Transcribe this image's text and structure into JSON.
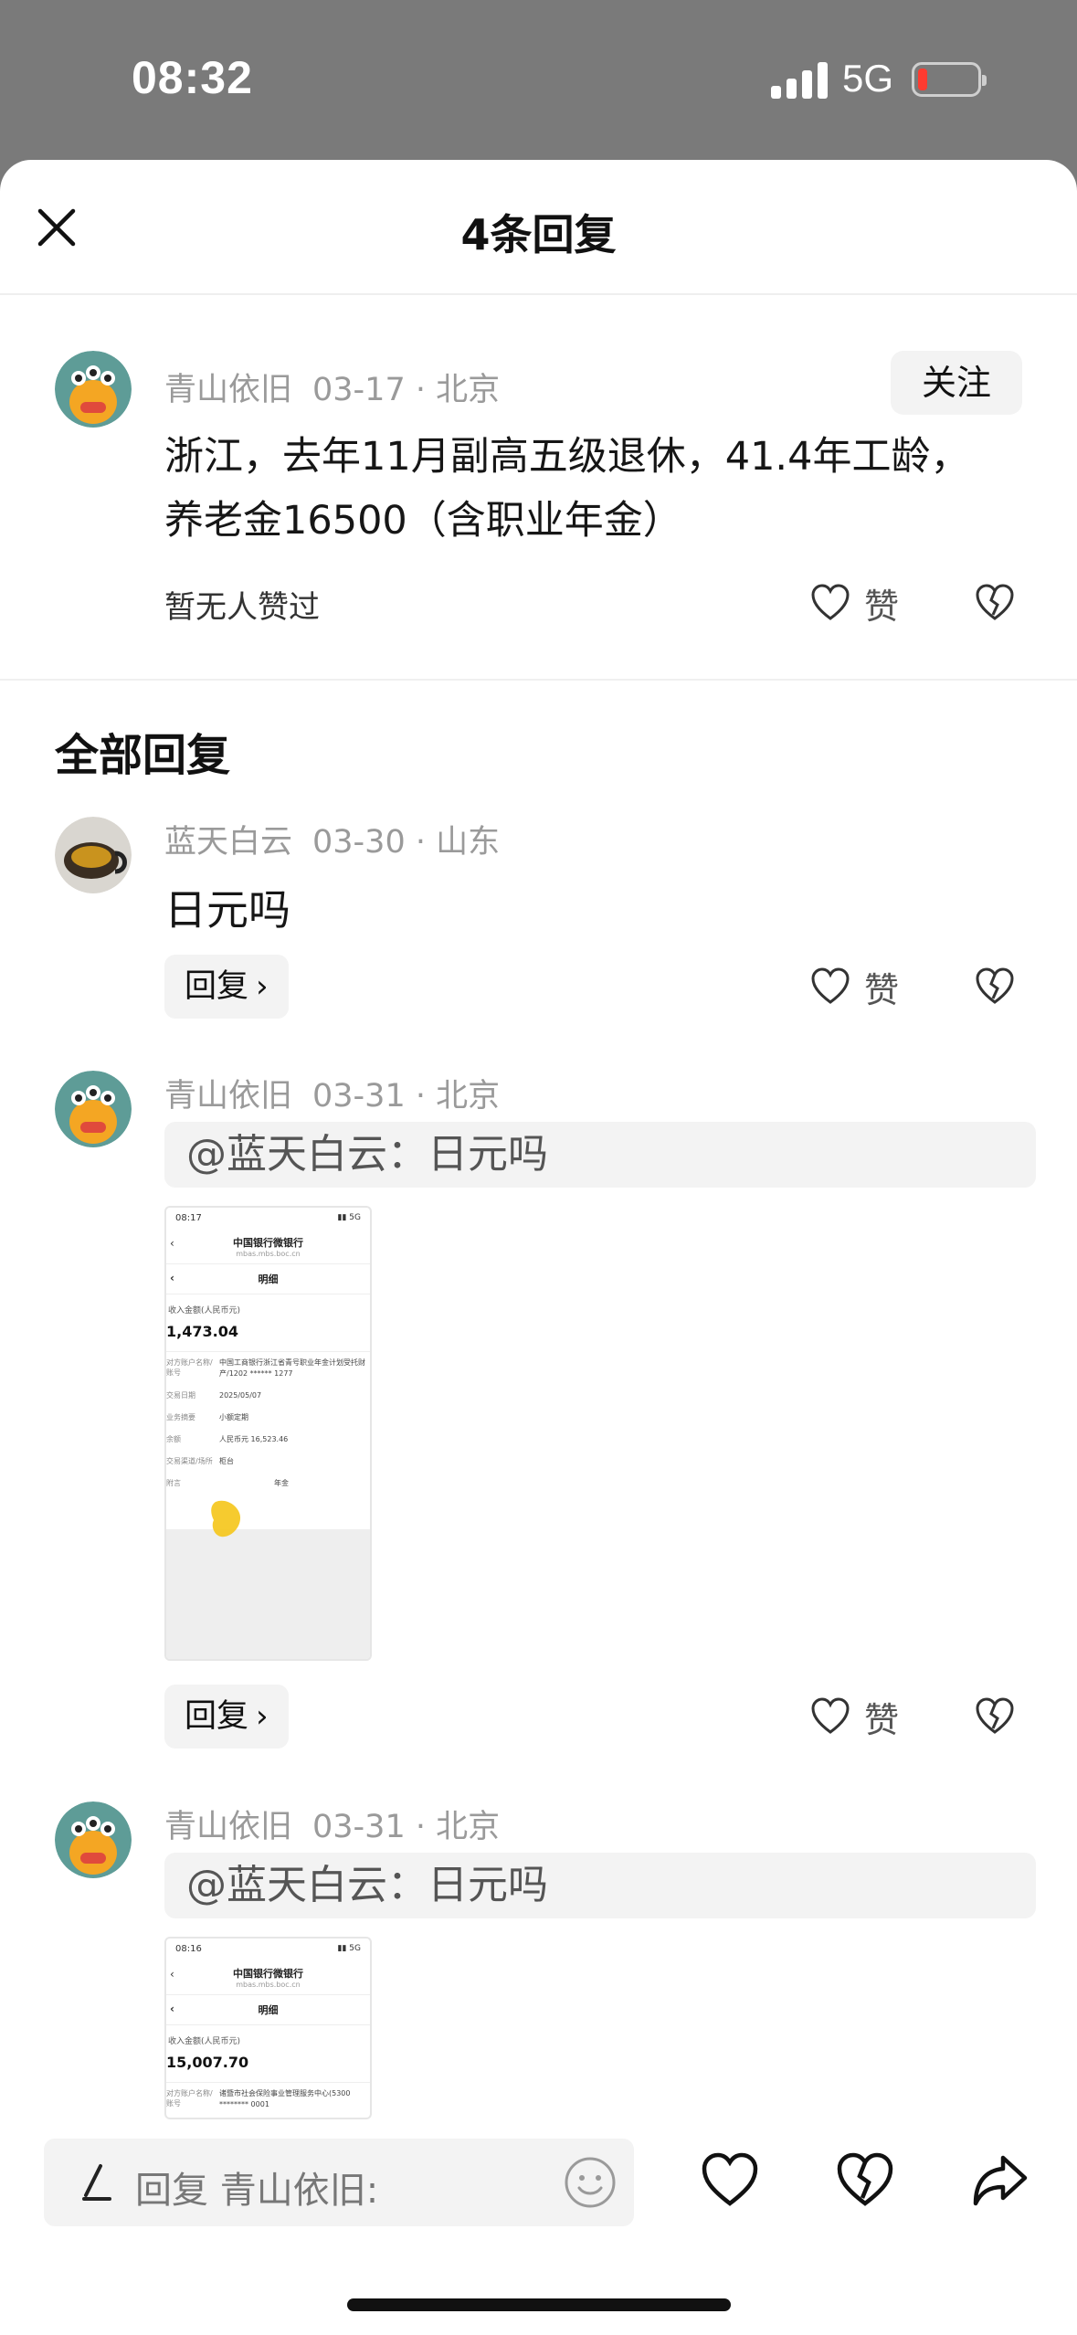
{
  "status_bar": {
    "time": "08:32",
    "network": "5G"
  },
  "header": {
    "title": "4条回复"
  },
  "main_comment": {
    "user": "青山依旧",
    "meta": "03-17 · 北京",
    "follow_label": "关注",
    "text": "浙江，去年11月副高五级退休，41.4年工龄，养老金16500（含职业年金）",
    "likes_status": "暂无人赞过",
    "like_label": "赞"
  },
  "section_title": "全部回复",
  "replies": [
    {
      "user": "蓝天白云",
      "meta": "03-30 · 山东",
      "text": "日元吗",
      "reply_label": "回复",
      "like_label": "赞"
    },
    {
      "user": "青山依旧",
      "meta": "03-31 · 北京",
      "quote": "@蓝天白云：日元吗",
      "reply_label": "回复",
      "like_label": "赞",
      "screenshot": {
        "time": "08:17",
        "bank": "中国银行微银行",
        "url": "mbas.mbs.boc.cn",
        "page": "明细",
        "amount_label": "收入金额(人民币元)",
        "amount": "1,473.04",
        "rows": [
          {
            "k": "对方账户名称/账号",
            "v": "中国工商银行浙江省青号职业年金计划受托财产/1202 ****** 1277"
          },
          {
            "k": "交易日期",
            "v": "2025/05/07"
          },
          {
            "k": "业务摘要",
            "v": "小额定期"
          },
          {
            "k": "余额",
            "v": "人民币元  16,523.46"
          },
          {
            "k": "交易渠道/场所",
            "v": "柜台"
          },
          {
            "k": "附言",
            "v": "年金"
          }
        ]
      }
    },
    {
      "user": "青山依旧",
      "meta": "03-31 · 北京",
      "quote": "@蓝天白云：日元吗",
      "screenshot": {
        "time": "08:16",
        "bank": "中国银行微银行",
        "url": "mbas.mbs.boc.cn",
        "page": "明细",
        "amount_label": "收入金额(人民币元)",
        "amount": "15,007.70",
        "rows": [
          {
            "k": "对方账户名称/账号",
            "v": "诸暨市社会保险事业管理服务中心(5300 ******** 0001"
          }
        ]
      }
    }
  ],
  "footer": {
    "input_placeholder": "回复 青山依旧:"
  },
  "icons": {
    "close": "close-icon",
    "heart": "heart-icon",
    "broken_heart": "broken-heart-icon",
    "pen": "pen-icon",
    "emoji": "emoji-icon",
    "share": "share-icon"
  },
  "colors": {
    "accent_gray": "#f3f3f3",
    "battery_low": "#ff3b30",
    "status_bg": "#7a7a7a"
  }
}
